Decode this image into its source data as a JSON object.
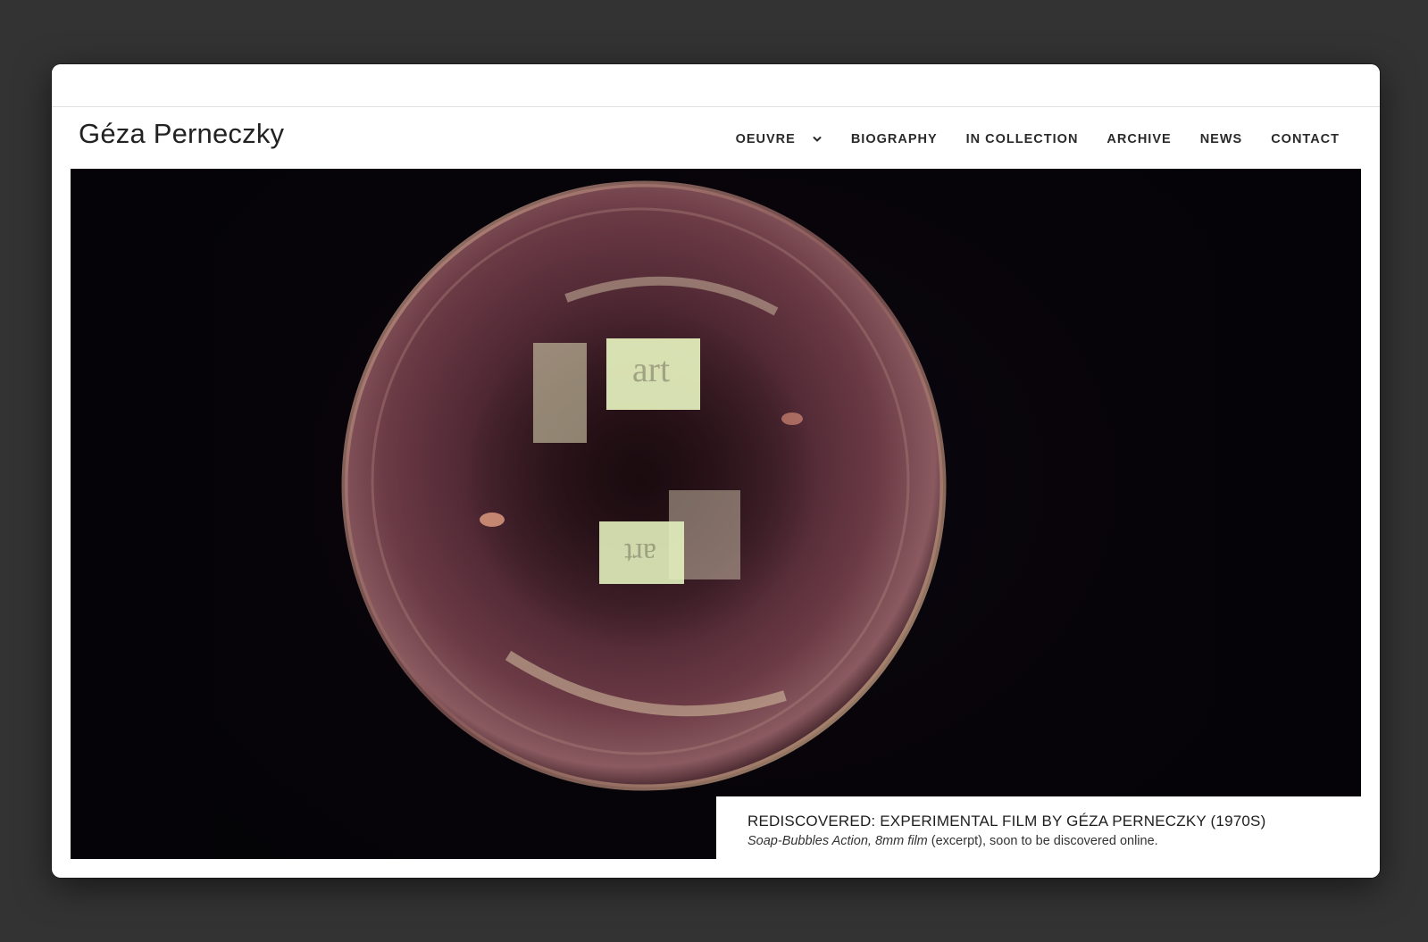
{
  "site": {
    "title": "Géza Perneczky"
  },
  "nav": {
    "items": [
      {
        "label": "OEUVRE",
        "has_dropdown": true
      },
      {
        "label": "BIOGRAPHY"
      },
      {
        "label": "IN COLLECTION"
      },
      {
        "label": "ARCHIVE"
      },
      {
        "label": "NEWS"
      },
      {
        "label": "CONTACT"
      }
    ]
  },
  "hero": {
    "bubble_text_top": "art",
    "bubble_text_bottom": "art"
  },
  "caption": {
    "title": "REDISCOVERED: EXPERIMENTAL FILM BY GÉZA PERNECZKY (1970S)",
    "subtitle_italic": "Soap-Bubbles Action, 8mm film",
    "subtitle_rest": " (excerpt), soon to be discovered online."
  },
  "colors": {
    "background": "#333333",
    "window": "#ffffff",
    "text": "#222222",
    "hero_bg": "#050308",
    "bubble_tint": "#6b3a45"
  },
  "icons": {
    "dropdown": "chevron-down-icon"
  }
}
